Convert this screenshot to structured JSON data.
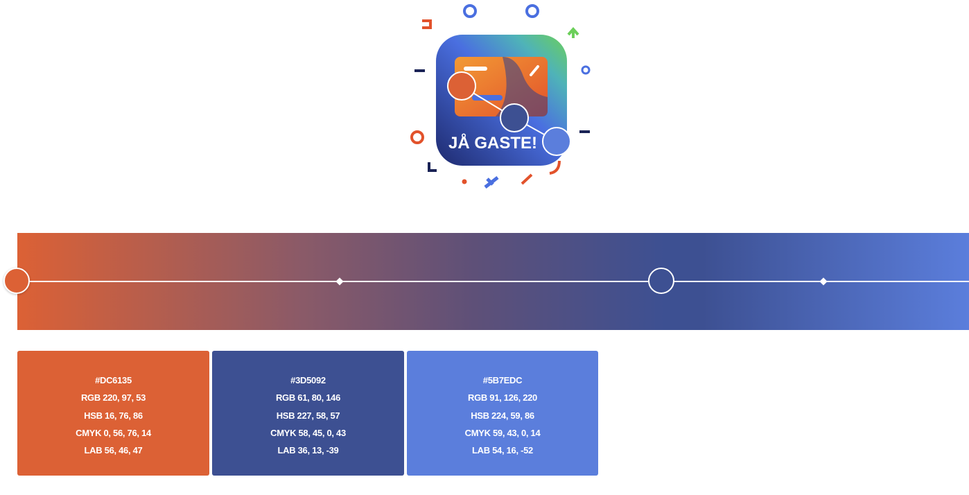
{
  "logo": {
    "text": "JÅ GASTE!"
  },
  "gradient": {
    "colors": {
      "start": "#DC6135",
      "middle": "#3D5092",
      "end": "#5B7EDC"
    }
  },
  "swatches": [
    {
      "hex": "#DC6135",
      "rgb": "RGB 220, 97, 53",
      "hsb": "HSB 16, 76, 86",
      "cmyk": "CMYK 0, 56, 76, 14",
      "lab": "LAB 56, 46, 47"
    },
    {
      "hex": "#3D5092",
      "rgb": "RGB 61, 80, 146",
      "hsb": "HSB 227, 58, 57",
      "cmyk": "CMYK 58, 45, 0, 43",
      "lab": "LAB 36, 13, -39"
    },
    {
      "hex": "#5B7EDC",
      "rgb": "RGB 91, 126, 220",
      "hsb": "HSB 224, 59, 86",
      "cmyk": "CMYK 59, 43, 0, 14",
      "lab": "LAB 54, 16, -52"
    }
  ]
}
